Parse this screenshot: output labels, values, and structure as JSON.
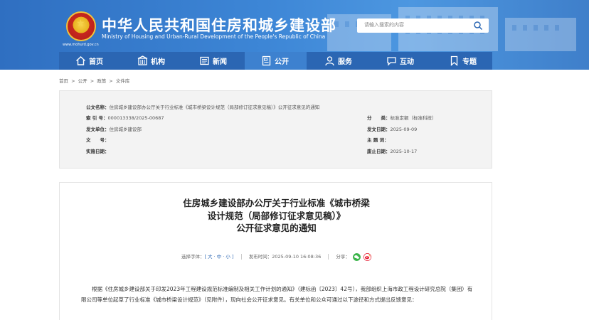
{
  "header": {
    "title": "中华人民共和国住房和城乡建设部",
    "subtitle": "Ministry of Housing and Urban-Rural Development of the People's Republic of China",
    "url": "www.mohurd.gov.cn",
    "search_placeholder": "请输入搜索的内容",
    "colors": {
      "header_bg": "#3d86d6",
      "nav_bg": "#2b66b3",
      "nav_active": "#3d81cf"
    }
  },
  "nav": {
    "items": [
      {
        "label": "首页",
        "icon": "home-icon"
      },
      {
        "label": "机构",
        "icon": "building-icon"
      },
      {
        "label": "新闻",
        "icon": "news-icon"
      },
      {
        "label": "公开",
        "icon": "document-icon",
        "active": true
      },
      {
        "label": "服务",
        "icon": "person-icon"
      },
      {
        "label": "互动",
        "icon": "chat-icon"
      },
      {
        "label": "专题",
        "icon": "bookmark-icon"
      }
    ]
  },
  "breadcrumb": [
    "首页",
    "公开",
    "政策",
    "文件库"
  ],
  "breadcrumb_sep": ">",
  "meta": {
    "doc_name_label": "公文名称：",
    "doc_name": "住房城乡建设部办公厅关于行业标准《城市桥梁设计规范（局部修订征求意见稿）》公开征求意见的通知",
    "index_label": "索 引 号：",
    "index": "000013338/2025-00687",
    "category_label": "分　　类：",
    "category": "标准定额（标准科技）",
    "issuer_label": "发文单位：",
    "issuer": "住房城乡建设部",
    "issue_date_label": "发文日期：",
    "issue_date": "2025-09-09",
    "docno_label": "文　　号：",
    "docno": "",
    "keywords_label": "主 题 词：",
    "keywords": "",
    "effective_label": "实施日期：",
    "effective": "",
    "expire_label": "废止日期：",
    "expire": "2025-10-17"
  },
  "article": {
    "title_line1": "住房城乡建设部办公厅关于行业标准《城市桥梁",
    "title_line2": "设计规范（局部修订征求意见稿）》",
    "title_line3": "公开征求意见的通知",
    "font_label": "选择字体：",
    "font_options": "[ 大 · 中 · 小 ]",
    "publish_label": "发布时间：",
    "publish_time": "2025-09-10 16:08:36",
    "share_label": "分享：",
    "body": "根据《住房城乡建设部关于印发2023年工程建设规范标准编制及相关工作计划的通知》（建标函〔2023〕42号），我部组织上海市政工程设计研究总院（集团）有限公司等单位起草了行业标准《城市桥梁设计规范》（见附件），现向社会公开征求意见。有关单位和公众可通过以下途径和方式提出反馈意见："
  }
}
